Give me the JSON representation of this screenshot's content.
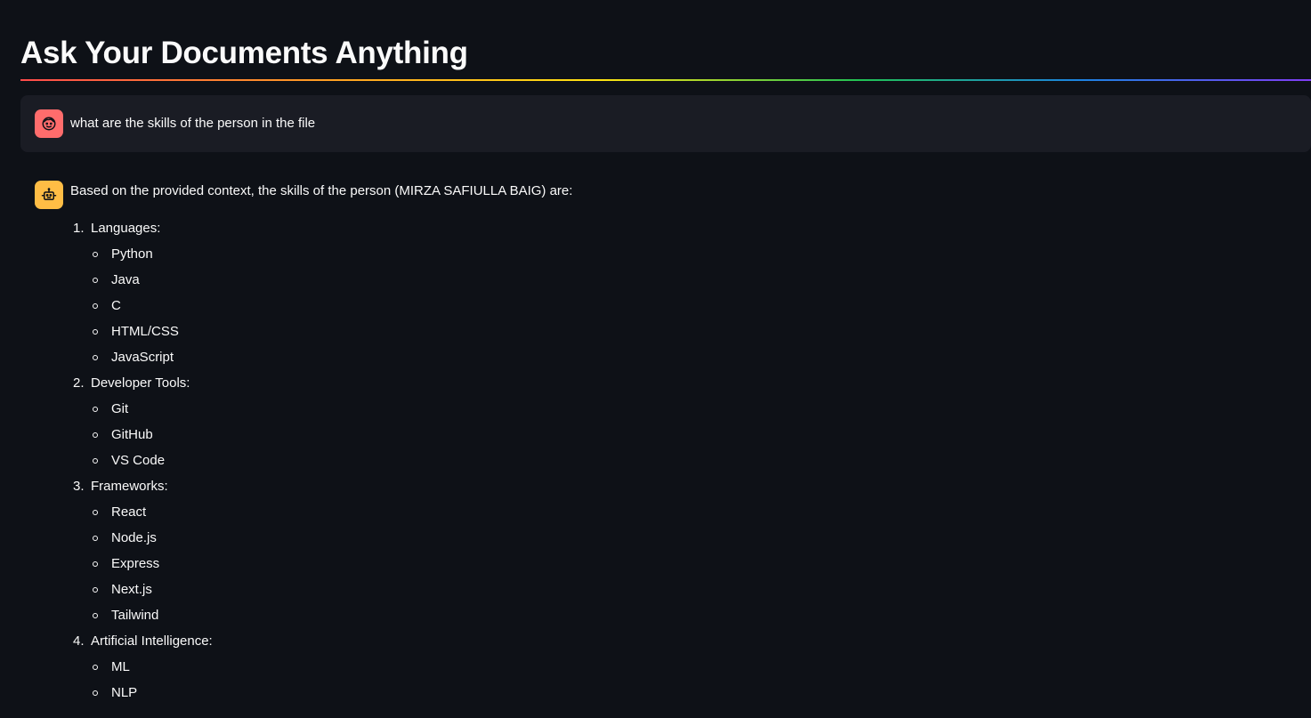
{
  "page": {
    "title": "Ask Your Documents Anything"
  },
  "chat": {
    "user_message": {
      "avatar_icon": "smiling-face-icon",
      "avatar_color": "#ff6c6c",
      "text": "what are the skills of the person in the file"
    },
    "assistant_message": {
      "avatar_icon": "robot-icon",
      "avatar_color": "#ffbd45",
      "intro": "Based on the provided context, the skills of the person (MIRZA SAFIULLA BAIG) are:",
      "categories": [
        {
          "number": "1.",
          "label": "Languages:",
          "items": [
            "Python",
            "Java",
            "C",
            "HTML/CSS",
            "JavaScript"
          ]
        },
        {
          "number": "2.",
          "label": "Developer Tools:",
          "items": [
            "Git",
            "GitHub",
            "VS Code"
          ]
        },
        {
          "number": "3.",
          "label": "Frameworks:",
          "items": [
            "React",
            "Node.js",
            "Express",
            "Next.js",
            "Tailwind"
          ]
        },
        {
          "number": "4.",
          "label": "Artificial Intelligence:",
          "items": [
            "ML",
            "NLP"
          ]
        }
      ]
    }
  },
  "theme": {
    "background": "#0e1117",
    "user_bubble": "#1a1c24",
    "text": "#fafafa"
  }
}
